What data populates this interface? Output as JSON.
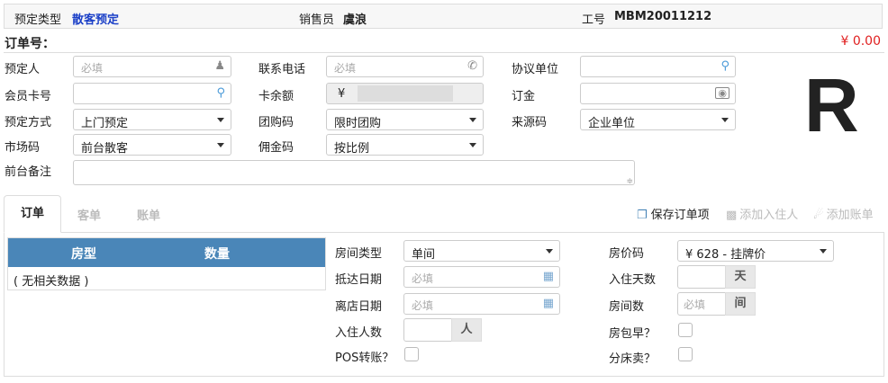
{
  "top_bar": {
    "booking_type_label": "预定类型",
    "booking_type_value": "散客预定",
    "salesperson_label": "销售员",
    "salesperson_value": "虞浪",
    "staff_no_label": "工号",
    "staff_no_value": "MBM20011212"
  },
  "order": {
    "order_no_label": "订单号：",
    "amount": "¥ 0.00",
    "big_letter": "R"
  },
  "form": {
    "booker_label": "预定人",
    "booker_placeholder": "必填",
    "phone_label": "联系电话",
    "phone_placeholder": "必填",
    "agreement_label": "协议单位",
    "member_card_label": "会员卡号",
    "card_balance_label": "卡余额",
    "card_balance_currency": "¥",
    "deposit_label": "订金",
    "booking_method_label": "预定方式",
    "booking_method_value": "上门预定",
    "group_code_label": "团购码",
    "group_code_value": "限时团购",
    "source_code_label": "来源码",
    "source_code_value": "企业单位",
    "market_code_label": "市场码",
    "market_code_value": "前台散客",
    "commission_code_label": "佣金码",
    "commission_code_value": "按比例",
    "remark_label": "前台备注"
  },
  "tabs": [
    {
      "label": "订单",
      "active": true
    },
    {
      "label": "客单",
      "active": false
    },
    {
      "label": "账单",
      "active": false
    }
  ],
  "actions": {
    "save_order_item": "保存订单项",
    "add_guest": "添加入住人",
    "add_bill": "添加账单"
  },
  "room_table": {
    "headers": [
      "房型",
      "数量"
    ],
    "empty_text": "( 无相关数据 )",
    "header_color": "#4a86b8"
  },
  "room_form": {
    "room_type_label": "房间类型",
    "room_type_value": "单间",
    "arrival_date_label": "抵达日期",
    "arrival_date_placeholder": "必填",
    "departure_date_label": "离店日期",
    "departure_date_placeholder": "必填",
    "guest_count_label": "入住人数",
    "guest_count_unit": "人",
    "pos_transfer_label": "POS转账？",
    "room_rate_code_label": "房价码",
    "room_rate_code_value": "¥ 628 - 挂牌价",
    "nights_label": "入住天数",
    "nights_unit": "天",
    "room_count_label": "房间数",
    "room_count_placeholder": "必填",
    "room_count_unit": "间",
    "breakfast_label": "房包早？",
    "split_bed_label": "分床卖？"
  },
  "colors": {
    "accent_blue": "#1a3fc7",
    "amount_red": "#e02020",
    "table_header": "#4a86b8"
  }
}
